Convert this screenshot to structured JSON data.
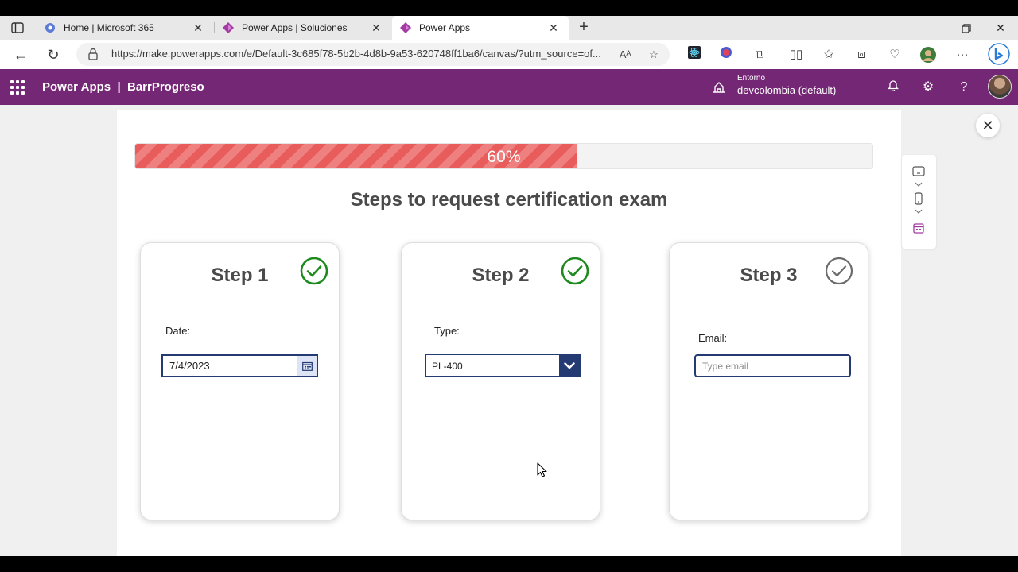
{
  "browser": {
    "tabs": [
      {
        "label": "Home | Microsoft 365",
        "icon": "microsoft365-icon",
        "active": false
      },
      {
        "label": "Power Apps | Soluciones",
        "icon": "powerapps-icon",
        "active": false
      },
      {
        "label": "Power Apps",
        "icon": "powerapps-icon",
        "active": true
      }
    ],
    "url": "https://make.powerapps.com/e/Default-3c685f78-5b2b-4d8b-9a53-620748ff1ba6/canvas/?utm_source=of...",
    "new_tab_symbol": "+",
    "window_controls": [
      "minimize-icon",
      "restore-icon",
      "close-icon"
    ]
  },
  "header": {
    "app_title": "Power Apps  |  BarrProgreso",
    "environment_label": "Entorno",
    "environment_value": "devcolombia (default)",
    "brand_color": "#742774"
  },
  "progress": {
    "value": 0.6,
    "text": "60%",
    "fill_color": "#e85c5c"
  },
  "page": {
    "title": "Steps to request certification exam"
  },
  "steps": [
    {
      "title": "Step 1",
      "done": true,
      "field_label": "Date:",
      "field_type": "datepicker",
      "value": "7/4/2023"
    },
    {
      "title": "Step 2",
      "done": true,
      "field_label": "Type:",
      "field_type": "dropdown",
      "value": "PL-400"
    },
    {
      "title": "Step 3",
      "done": false,
      "field_label": "Email:",
      "field_type": "textinput",
      "placeholder": "Type email",
      "value": ""
    }
  ],
  "colors": {
    "check_done": "#1e8a1e",
    "check_pending": "#6b6b6b",
    "control_border": "#243a73"
  },
  "studio": {
    "close_symbol": "✕"
  }
}
